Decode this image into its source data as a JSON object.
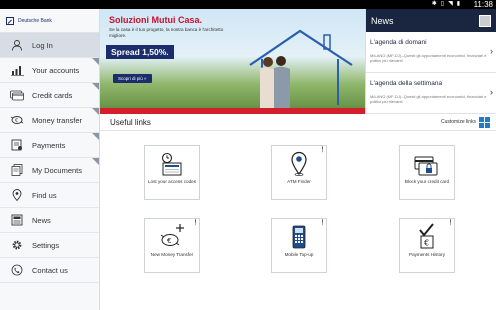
{
  "status_bar": {
    "time": "11:38",
    "icons": [
      "bluetooth-icon",
      "vibrate-icon",
      "wifi-icon",
      "battery-icon"
    ]
  },
  "brand": {
    "name": "Deutsche Bank"
  },
  "sidebar": {
    "items": [
      {
        "label": "Log In",
        "icon": "user-icon",
        "active": true
      },
      {
        "label": "Your accounts",
        "icon": "chart-icon"
      },
      {
        "label": "Credit cards",
        "icon": "credit-card-icon"
      },
      {
        "label": "Money transfer",
        "icon": "transfer-icon"
      },
      {
        "label": "Payments",
        "icon": "payment-icon"
      },
      {
        "label": "My Documents",
        "icon": "documents-icon"
      },
      {
        "label": "Find us",
        "icon": "map-pin-icon"
      },
      {
        "label": "News",
        "icon": "newspaper-icon"
      },
      {
        "label": "Settings",
        "icon": "gear-icon"
      },
      {
        "label": "Contact us",
        "icon": "phone-icon"
      }
    ]
  },
  "banner": {
    "headline": "Soluzioni Mutui Casa.",
    "body": "Se la casa è il tuo progetto, la nostra banca è l'architetto migliore.",
    "spread": "Spread 1,50%.",
    "cta": "Scopri di più »"
  },
  "news": {
    "title": "News",
    "items": [
      {
        "title": "L'agenda di domani",
        "desc": "MILANO (MF-DJ)--Questi gli appuntamenti economici, finanziari e politici più rilevanti"
      },
      {
        "title": "L'agenda della settimana",
        "desc": "MILANO (MF-DJ)--Questi gli appuntamenti economici, finanziari e politici più rilevanti"
      }
    ]
  },
  "useful_links": {
    "title": "Useful links",
    "customize_label": "Customize links",
    "tiles": [
      {
        "label": "Lost your access codes",
        "icon": "lost-codes-icon"
      },
      {
        "label": "ATM Finder",
        "icon": "atm-pin-icon",
        "pinned": true
      },
      {
        "label": "Block your credit card",
        "icon": "block-card-icon"
      },
      {
        "label": "New Money Transfer",
        "icon": "new-transfer-icon",
        "pinned": true
      },
      {
        "label": "Mobile Top-up",
        "icon": "mobile-topup-icon",
        "pinned": true
      },
      {
        "label": "Payments History",
        "icon": "payments-history-icon",
        "pinned": true
      }
    ]
  },
  "colors": {
    "brand_navy": "#1c2d6e",
    "header_dark": "#1a2640",
    "accent_red": "#c8102e",
    "accent_blue": "#1f7dc5"
  }
}
